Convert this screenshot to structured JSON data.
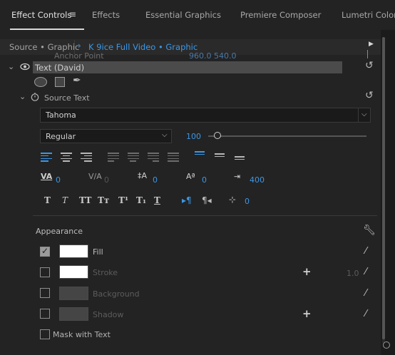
{
  "tabs": [
    {
      "label": "Effect Controls",
      "active": true
    },
    {
      "label": "Effects",
      "active": false
    },
    {
      "label": "Essential Graphics",
      "active": false
    },
    {
      "label": "Premiere Composer",
      "active": false
    },
    {
      "label": "Lumetri Color",
      "active": false
    }
  ],
  "tab_menu_glyph": "≡",
  "source": {
    "label": "Source • Graphic",
    "clip": "K 9ice Full Video • Graphic",
    "partial_row_label": "Anchor Point",
    "partial_row_value": "960.0    540.0"
  },
  "layer": {
    "label": "Text (David)"
  },
  "source_text": {
    "label": "Source Text",
    "font": "Tahoma",
    "style": "Regular",
    "size": "100",
    "size_fraction": 0.06
  },
  "spacing": {
    "kerning": "0",
    "tracking": "0",
    "leading": "0",
    "baseline": "0",
    "tsume": "400",
    "indent": "0"
  },
  "typo_buttons": [
    "T",
    "T",
    "TT",
    "Tт",
    "T¹",
    "T₁",
    "T"
  ],
  "appearance": {
    "label": "Appearance",
    "rows": [
      {
        "label": "Fill",
        "checked": true,
        "swatch": "#ffffff",
        "enabled": true
      },
      {
        "label": "Stroke",
        "checked": false,
        "swatch": "#ffffff",
        "enabled": false,
        "value": "1.0"
      },
      {
        "label": "Background",
        "checked": false,
        "swatch": "#454545",
        "enabled": false
      },
      {
        "label": "Shadow",
        "checked": false,
        "swatch": "#454545",
        "enabled": false
      }
    ],
    "mask_label": "Mask with Text"
  },
  "colors": {
    "accent": "#3c97e6",
    "row_highlight": "#4b4b4b"
  }
}
